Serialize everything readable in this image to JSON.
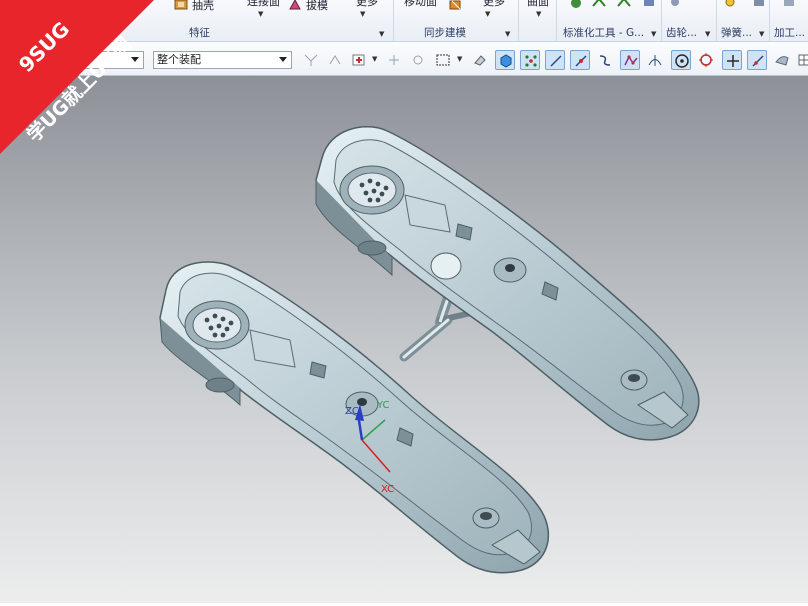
{
  "ribbon": {
    "items": {
      "shell": "抽壳",
      "draft": "拔模",
      "connected": "连接面",
      "more1": "更多",
      "move_face": "移动面",
      "more2": "更多",
      "surface": "曲面"
    },
    "groups": {
      "feature": "特征",
      "sync_modeling": "同步建模",
      "std_tools": "标准化工具 - G...",
      "gear": "齿轮...",
      "spring": "弹簧...",
      "machining": "加工..."
    }
  },
  "toolbar": {
    "filter_value": "",
    "assembly_scope": "整个装配"
  },
  "viewport": {
    "axes": {
      "x": "XC",
      "y": "YC",
      "z": "ZC"
    },
    "colors": {
      "x": "#d22020",
      "y": "#2ea04a",
      "z": "#2a3fc0",
      "part": "#cfdde2"
    }
  },
  "watermark": {
    "line1": "9SUG",
    "line2": "学UG就上UG网"
  }
}
